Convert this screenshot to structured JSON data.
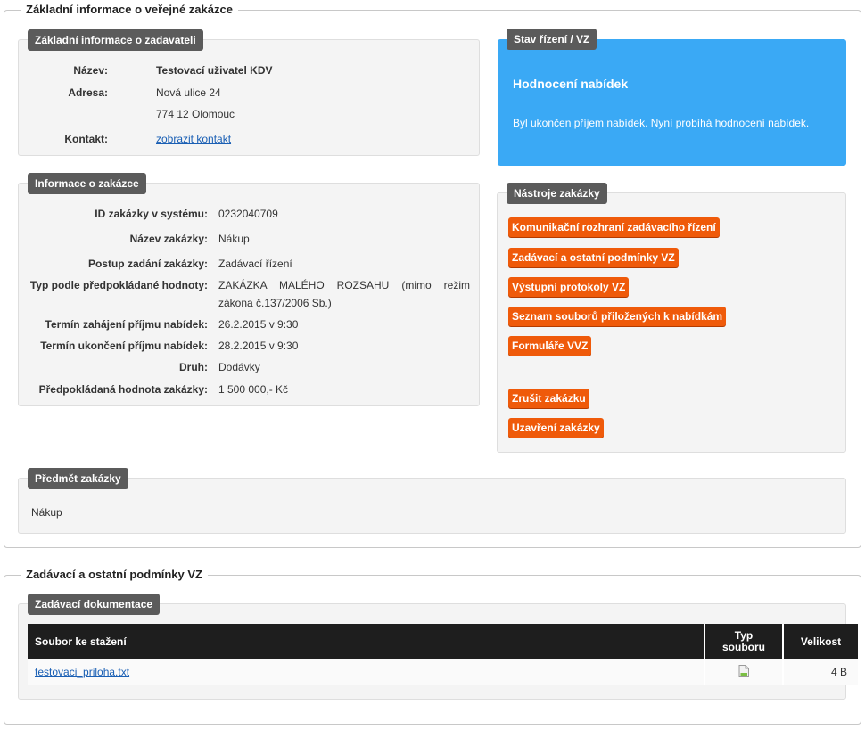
{
  "section1": {
    "legend": "Základní informace o veřejné zakázce",
    "contracting": {
      "title": "Základní informace o zadavateli",
      "name_label": "Název:",
      "name_value": "Testovací uživatel KDV",
      "address_label": "Adresa:",
      "address_line1": "Nová ulice 24",
      "address_line2": "774 12 Olomouc",
      "contact_label": "Kontakt:",
      "contact_link": "zobrazit kontakt"
    },
    "info": {
      "title": "Informace o zakázce",
      "rows": [
        {
          "label": "ID zakázky v systému:",
          "value": "0232040709"
        },
        {
          "label": "Název zakázky:",
          "value": "Nákup"
        },
        {
          "label": "Postup zadání zakázky:",
          "value": "Zadávací řízení"
        },
        {
          "label": "Typ podle předpokládané hodnoty:",
          "value": "ZAKÁZKA MALÉHO ROZSAHU (mimo režim",
          "value2": "zákona č.137/2006 Sb.)"
        },
        {
          "label": "Termín zahájení příjmu nabídek:",
          "value": "26.2.2015 v 9:30"
        },
        {
          "label": "Termín ukončení příjmu nabídek:",
          "value": "28.2.2015 v 9:30"
        },
        {
          "label": "Druh:",
          "value": "Dodávky"
        },
        {
          "label": "Předpokládaná hodnota zakázky:",
          "value": "1 500 000,- Kč"
        }
      ]
    },
    "state": {
      "title": "Stav řízení / VZ",
      "heading": "Hodnocení nabídek",
      "text": "Byl ukončen příjem nabídek. Nyní probíhá hodnocení nabídek."
    },
    "tools": {
      "title": "Nástroje zakázky",
      "buttons": [
        "Komunikační rozhraní zadávacího řízení",
        "Zadávací a ostatní podmínky VZ",
        "Výstupní protokoly VZ",
        "Seznam souborů přiložených k nabídkám",
        "Formuláře VVZ",
        "Zrušit zakázku",
        "Uzavření zakázky"
      ]
    },
    "subject": {
      "title": "Předmět zakázky",
      "text": "Nákup"
    }
  },
  "section2": {
    "legend": "Zadávací a ostatní podmínky VZ",
    "docs": {
      "title": "Zadávací dokumentace",
      "col_file": "Soubor ke stažení",
      "col_type_1": "Typ",
      "col_type_2": "souboru",
      "col_size": "Velikost",
      "rows": [
        {
          "file": "testovaci_priloha.txt",
          "type_icon": "text-file-icon",
          "size": "4 B"
        }
      ]
    }
  },
  "colors": {
    "state_bg": "#3aa9f5",
    "button_orange": "#ef5a0a",
    "panel_title_bg": "#5b5b5b",
    "table_header_bg": "#1e1e1e"
  }
}
